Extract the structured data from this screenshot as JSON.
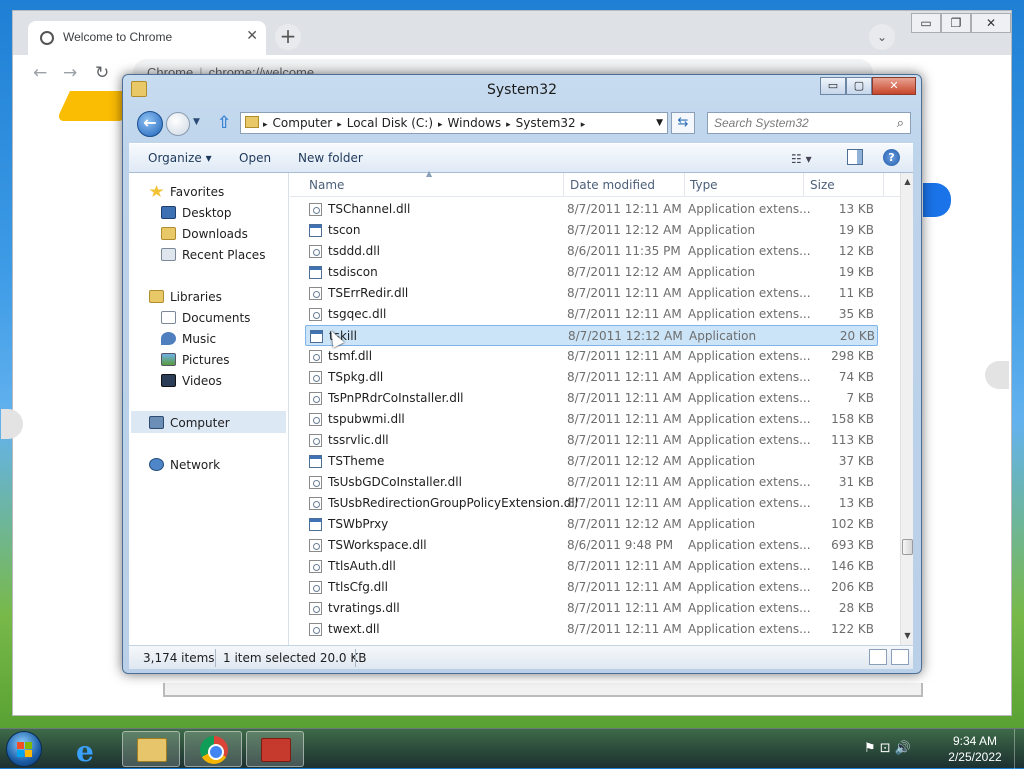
{
  "chrome": {
    "tab_title": "Welcome to Chrome",
    "tab_close": "✕",
    "new_tab": "+",
    "tab_dropdown": "⌄",
    "url_label": "Chrome",
    "url_separator": "|",
    "url": "chrome://welcome",
    "back": "←",
    "forward": "→",
    "reload": "↻",
    "minimize": "▭",
    "restore": "❐",
    "close": "✕"
  },
  "explorer": {
    "title": "System32",
    "controls": {
      "minimize": "▭",
      "maximize": "▢",
      "close": "✕"
    },
    "back_icon": "←",
    "history_arrow": "▼",
    "up_icon": "⇧",
    "refresh_icon": "⇆",
    "breadcrumb": [
      "Computer",
      "Local Disk (C:)",
      "Windows",
      "System32"
    ],
    "breadcrumb_separator": "▸",
    "breadcrumb_dropdown": "▼",
    "search_placeholder": "Search System32",
    "search_icon": "⌕",
    "commands": {
      "organize": "Organize ▾",
      "open": "Open",
      "new_folder": "New folder"
    },
    "view_icon": "☷ ▾",
    "help_icon": "?",
    "nav": {
      "favorites": "Favorites",
      "desktop": "Desktop",
      "downloads": "Downloads",
      "recent_places": "Recent Places",
      "libraries": "Libraries",
      "documents": "Documents",
      "music": "Music",
      "pictures": "Pictures",
      "videos": "Videos",
      "computer": "Computer",
      "network": "Network"
    },
    "columns": {
      "name": "Name",
      "date": "Date modified",
      "type": "Type",
      "size": "Size",
      "sort_indicator": "▲"
    },
    "files": [
      {
        "name": "TSChannel.dll",
        "date": "8/7/2011 12:11 AM",
        "type": "Application extens...",
        "size": "13 KB",
        "kind": "dll"
      },
      {
        "name": "tscon",
        "date": "8/7/2011 12:12 AM",
        "type": "Application",
        "size": "19 KB",
        "kind": "app"
      },
      {
        "name": "tsddd.dll",
        "date": "8/6/2011 11:35 PM",
        "type": "Application extens...",
        "size": "12 KB",
        "kind": "dll"
      },
      {
        "name": "tsdiscon",
        "date": "8/7/2011 12:12 AM",
        "type": "Application",
        "size": "19 KB",
        "kind": "app"
      },
      {
        "name": "TSErrRedir.dll",
        "date": "8/7/2011 12:11 AM",
        "type": "Application extens...",
        "size": "11 KB",
        "kind": "dll"
      },
      {
        "name": "tsgqec.dll",
        "date": "8/7/2011 12:11 AM",
        "type": "Application extens...",
        "size": "35 KB",
        "kind": "dll"
      },
      {
        "name": "tskill",
        "date": "8/7/2011 12:12 AM",
        "type": "Application",
        "size": "20 KB",
        "kind": "app",
        "selected": true
      },
      {
        "name": "tsmf.dll",
        "date": "8/7/2011 12:11 AM",
        "type": "Application extens...",
        "size": "298 KB",
        "kind": "dll"
      },
      {
        "name": "TSpkg.dll",
        "date": "8/7/2011 12:11 AM",
        "type": "Application extens...",
        "size": "74 KB",
        "kind": "dll"
      },
      {
        "name": "TsPnPRdrCoInstaller.dll",
        "date": "8/7/2011 12:11 AM",
        "type": "Application extens...",
        "size": "7 KB",
        "kind": "dll"
      },
      {
        "name": "tspubwmi.dll",
        "date": "8/7/2011 12:11 AM",
        "type": "Application extens...",
        "size": "158 KB",
        "kind": "dll"
      },
      {
        "name": "tssrvlic.dll",
        "date": "8/7/2011 12:11 AM",
        "type": "Application extens...",
        "size": "113 KB",
        "kind": "dll"
      },
      {
        "name": "TSTheme",
        "date": "8/7/2011 12:12 AM",
        "type": "Application",
        "size": "37 KB",
        "kind": "app"
      },
      {
        "name": "TsUsbGDCoInstaller.dll",
        "date": "8/7/2011 12:11 AM",
        "type": "Application extens...",
        "size": "31 KB",
        "kind": "dll"
      },
      {
        "name": "TsUsbRedirectionGroupPolicyExtension.dll",
        "date": "8/7/2011 12:11 AM",
        "type": "Application extens...",
        "size": "13 KB",
        "kind": "dll"
      },
      {
        "name": "TSWbPrxy",
        "date": "8/7/2011 12:12 AM",
        "type": "Application",
        "size": "102 KB",
        "kind": "app"
      },
      {
        "name": "TSWorkspace.dll",
        "date": "8/6/2011 9:48 PM",
        "type": "Application extens...",
        "size": "693 KB",
        "kind": "dll"
      },
      {
        "name": "TtlsAuth.dll",
        "date": "8/7/2011 12:11 AM",
        "type": "Application extens...",
        "size": "146 KB",
        "kind": "dll"
      },
      {
        "name": "TtlsCfg.dll",
        "date": "8/7/2011 12:11 AM",
        "type": "Application extens...",
        "size": "206 KB",
        "kind": "dll"
      },
      {
        "name": "tvratings.dll",
        "date": "8/7/2011 12:11 AM",
        "type": "Application extens...",
        "size": "28 KB",
        "kind": "dll"
      },
      {
        "name": "twext.dll",
        "date": "8/7/2011 12:11 AM",
        "type": "Application extens...",
        "size": "122 KB",
        "kind": "dll"
      }
    ],
    "status": {
      "items": "3,174 items",
      "selected": "1 item selected  20.0 KB"
    }
  },
  "taskbar": {
    "time": "9:34 AM",
    "date": "2/25/2022",
    "ie_glyph": "e",
    "tray_icons": "⚑ ⊡ 🔊"
  },
  "colors": {
    "selection": "#cce4f7",
    "selection_border": "#7eb4ea",
    "title_text": "#1b1b1b",
    "link": "#1e395b"
  }
}
